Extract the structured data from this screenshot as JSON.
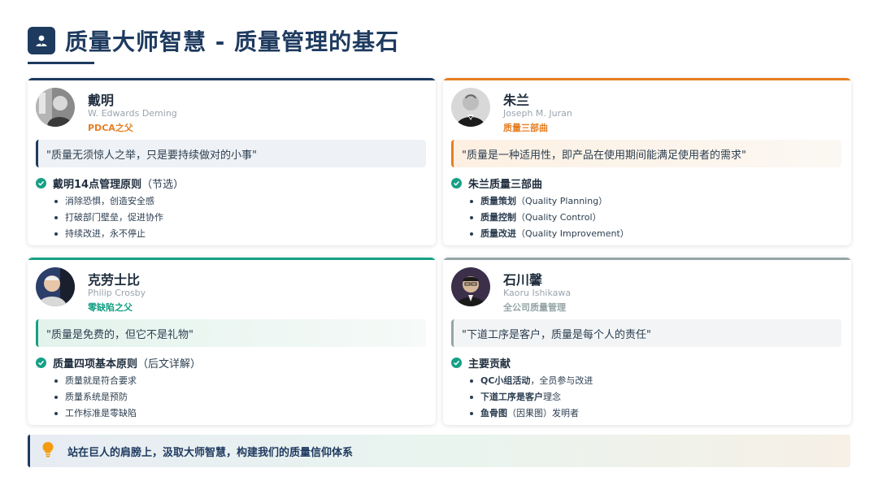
{
  "title": "质量大师智慧 - 质量管理的基石",
  "colors": {
    "navy": "#1e3a5f",
    "orange": "#e67e22",
    "green": "#16a085",
    "gray": "#95a5a6"
  },
  "cards": [
    {
      "name": "戴明",
      "english": "W. Edwards Deming",
      "tag": "PDCA之父",
      "quote": "\"质量无须惊人之举，只是要持续做对的小事\"",
      "section_bold": "戴明14点管理原则",
      "section_note": "（节选）",
      "items": [
        {
          "bold": "",
          "text": "消除恐惧，创造安全感"
        },
        {
          "bold": "",
          "text": "打破部门壁垒，促进协作"
        },
        {
          "bold": "",
          "text": "持续改进，永不停止"
        }
      ]
    },
    {
      "name": "朱兰",
      "english": "Joseph M. Juran",
      "tag": "质量三部曲",
      "quote": "\"质量是一种适用性，即产品在使用期间能满足使用者的需求\"",
      "section_bold": "朱兰质量三部曲",
      "section_note": "",
      "items": [
        {
          "bold": "质量策划",
          "text": "（Quality Planning）"
        },
        {
          "bold": "质量控制",
          "text": "（Quality Control）"
        },
        {
          "bold": "质量改进",
          "text": "（Quality Improvement）"
        }
      ]
    },
    {
      "name": "克劳士比",
      "english": "Philip Crosby",
      "tag": "零缺陷之父",
      "quote": "\"质量是免费的，但它不是礼物\"",
      "section_bold": "质量四项基本原则",
      "section_note": "（后文详解）",
      "items": [
        {
          "bold": "",
          "text": "质量就是符合要求"
        },
        {
          "bold": "",
          "text": "质量系统是预防"
        },
        {
          "bold": "",
          "text": "工作标准是零缺陷"
        }
      ]
    },
    {
      "name": "石川馨",
      "english": "Kaoru Ishikawa",
      "tag": "全公司质量管理",
      "quote": "\"下道工序是客户，质量是每个人的责任\"",
      "section_bold": "主要贡献",
      "section_note": "",
      "items": [
        {
          "bold": "QC小组活动",
          "text": "，全员参与改进"
        },
        {
          "bold": "下道工序是客户",
          "text": "理念"
        },
        {
          "bold": "鱼骨图",
          "text": "（因果图）发明者"
        }
      ]
    }
  ],
  "footer": "站在巨人的肩膀上，汲取大师智慧，构建我们的质量信仰体系"
}
